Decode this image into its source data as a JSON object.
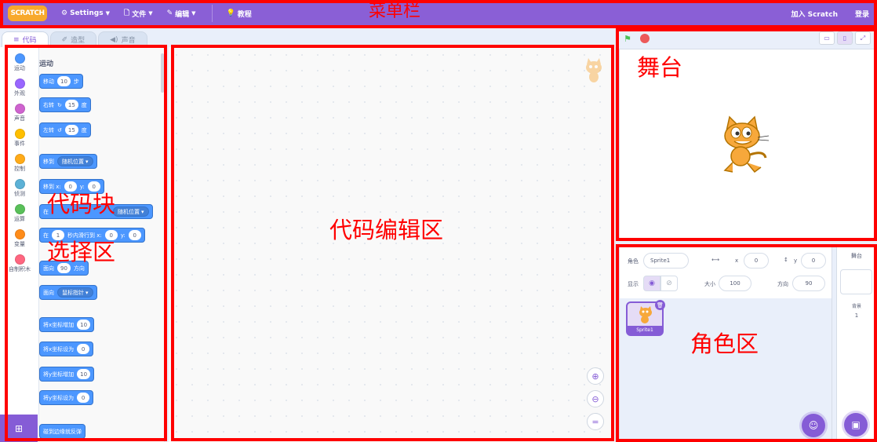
{
  "menubar": {
    "logo": "SCRATCH",
    "settings": "Settings",
    "file": "文件",
    "edit": "编辑",
    "tutorials": "教程",
    "join": "加入 Scratch",
    "signin": "登录"
  },
  "tabs": [
    {
      "label": "代码"
    },
    {
      "label": "造型"
    },
    {
      "label": "声音"
    }
  ],
  "categories": [
    {
      "label": "运动",
      "color": "#4c97ff"
    },
    {
      "label": "外观",
      "color": "#9966ff"
    },
    {
      "label": "声音",
      "color": "#cf63cf"
    },
    {
      "label": "事件",
      "color": "#ffbf00"
    },
    {
      "label": "控制",
      "color": "#ffab19"
    },
    {
      "label": "侦测",
      "color": "#5cb1d6"
    },
    {
      "label": "运算",
      "color": "#59c059"
    },
    {
      "label": "变量",
      "color": "#ff8c1a"
    },
    {
      "label": "自制积木",
      "color": "#ff6680"
    }
  ],
  "palette": {
    "section_title": "运动",
    "move_prefix": "移动",
    "move_steps": "10",
    "move_suffix": "步",
    "turn_right": "右转",
    "turn_right_deg": "15",
    "turn_right_suffix": "度",
    "turn_left": "左转",
    "turn_left_deg": "15",
    "turn_left_suffix": "度",
    "goto": "移到",
    "goto_option": "随机位置",
    "gotoxy": "移到 x:",
    "gotoxy_x": "0",
    "gotoxy_y_lbl": "y:",
    "gotoxy_y": "0",
    "glide_prefix": "在",
    "glide_option": "随机位置",
    "glidexy_prefix": "在",
    "glidexy_secs": "1",
    "glidexy_mid": "秒内滑行到 x:",
    "glidexy_x": "0",
    "glidexy_y_lbl": "y:",
    "glidexy_y": "0",
    "point_dir": "面向",
    "point_dir_val": "90",
    "point_dir_suffix": "方向",
    "point_towards": "面向",
    "point_towards_option": "鼠标指针",
    "change_x": "将x坐标增加",
    "change_x_val": "10",
    "set_x": "将x坐标设为",
    "set_x_val": "0",
    "change_y": "将y坐标增加",
    "change_y_val": "10",
    "set_y": "将y坐标设为",
    "set_y_val": "0",
    "bounce": "碰到边缘就反弹"
  },
  "sprite_info": {
    "sprite_lbl": "角色",
    "sprite_name": "Sprite1",
    "x_lbl": "x",
    "x_val": "0",
    "y_lbl": "y",
    "y_val": "0",
    "show_lbl": "显示",
    "size_lbl": "大小",
    "size_val": "100",
    "dir_lbl": "方向",
    "dir_val": "90"
  },
  "sprite_list": [
    {
      "name": "Sprite1"
    }
  ],
  "stage_panel": {
    "title": "舞台",
    "backdrops_lbl": "背景",
    "backdrops_count": "1"
  },
  "annotations": {
    "menubar": "菜单栏",
    "blocks": "代码块\n选择区",
    "blocks_line1": "代码块",
    "blocks_line2": "选择区",
    "code": "代码编辑区",
    "stage": "舞台",
    "sprites": "角色区",
    "color": "#ff0000"
  },
  "colors": {
    "scratch_purple": "#855cd6",
    "menubar": "#8a5fd6",
    "motion": "#4c97ff"
  }
}
